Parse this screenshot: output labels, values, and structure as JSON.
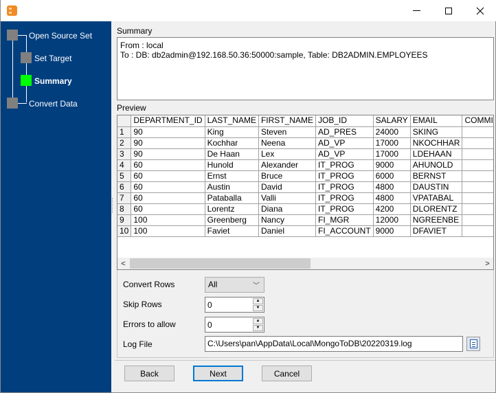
{
  "window": {
    "icons": {
      "app": "app-icon",
      "minimize": "minimize-icon",
      "maximize": "maximize-icon",
      "close": "close-icon"
    }
  },
  "sidebar": {
    "steps": [
      {
        "label": "Open Source Set",
        "state": "inactive"
      },
      {
        "label": "Set Target",
        "state": "inactive"
      },
      {
        "label": "Summary",
        "state": "active"
      },
      {
        "label": "Convert Data",
        "state": "inactive"
      }
    ],
    "colors": {
      "background": "#003e7e",
      "inactive_box": "#808080",
      "active_box": "#00ff00"
    }
  },
  "summary": {
    "label": "Summary",
    "lines": [
      "From : local",
      "To : DB: db2admin@192.168.50.36:50000:sample, Table: DB2ADMIN.EMPLOYEES"
    ]
  },
  "preview": {
    "label": "Preview",
    "columns": [
      "DEPARTMENT_ID",
      "LAST_NAME",
      "FIRST_NAME",
      "JOB_ID",
      "SALARY",
      "EMAIL",
      "COMMIS"
    ],
    "rows": [
      [
        "1",
        "90",
        "King",
        "Steven",
        "AD_PRES",
        "24000",
        "SKING",
        ""
      ],
      [
        "2",
        "90",
        "Kochhar",
        "Neena",
        "AD_VP",
        "17000",
        "NKOCHHAR",
        ""
      ],
      [
        "3",
        "90",
        "De Haan",
        "Lex",
        "AD_VP",
        "17000",
        "LDEHAAN",
        ""
      ],
      [
        "4",
        "60",
        "Hunold",
        "Alexander",
        "IT_PROG",
        "9000",
        "AHUNOLD",
        ""
      ],
      [
        "5",
        "60",
        "Ernst",
        "Bruce",
        "IT_PROG",
        "6000",
        "BERNST",
        ""
      ],
      [
        "6",
        "60",
        "Austin",
        "David",
        "IT_PROG",
        "4800",
        "DAUSTIN",
        ""
      ],
      [
        "7",
        "60",
        "Pataballa",
        "Valli",
        "IT_PROG",
        "4800",
        "VPATABAL",
        ""
      ],
      [
        "8",
        "60",
        "Lorentz",
        "Diana",
        "IT_PROG",
        "4200",
        "DLORENTZ",
        ""
      ],
      [
        "9",
        "100",
        "Greenberg",
        "Nancy",
        "FI_MGR",
        "12000",
        "NGREENBE",
        ""
      ],
      [
        "10",
        "100",
        "Faviet",
        "Daniel",
        "FI_ACCOUNT",
        "9000",
        "DFAVIET",
        ""
      ]
    ],
    "scroll": {
      "left_arrow": "<",
      "right_arrow": ">"
    }
  },
  "options": {
    "convert_rows": {
      "label": "Convert Rows",
      "value": "All",
      "chevron": "﹀"
    },
    "skip_rows": {
      "label": "Skip Rows",
      "value": "0"
    },
    "errors_to_allow": {
      "label": "Errors to allow",
      "value": "0"
    },
    "log_file": {
      "label": "Log File",
      "value": "C:\\Users\\pan\\AppData\\Local\\MongoToDB\\20220319.log",
      "browse_icon": "document-icon"
    },
    "spin_up": "▲",
    "spin_down": "▼"
  },
  "buttons": {
    "back": "Back",
    "next": "Next",
    "cancel": "Cancel"
  }
}
